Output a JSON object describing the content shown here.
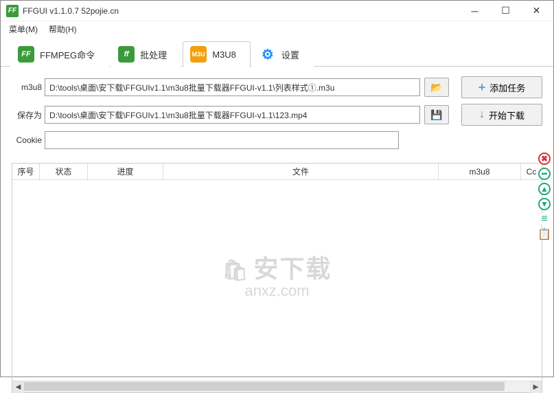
{
  "titlebar": {
    "icon_text": "FF",
    "title": "FFGUI v1.1.0.7    52pojie.cn"
  },
  "menubar": {
    "menu": "菜单(M)",
    "help": "帮助(H)"
  },
  "tabs": {
    "ffmpeg": "FFMPEG命令",
    "batch": "批处理",
    "m3u8": "M3U8",
    "settings": "设置",
    "icon_m3u8": "M3U"
  },
  "form": {
    "m3u8_label": "m3u8",
    "m3u8_value": "D:\\tools\\桌面\\安下载\\FFGUIv1.1\\m3u8批量下载器FFGUI-v1.1\\列表样式①.m3u",
    "save_label": "保存为",
    "save_value": "D:\\tools\\桌面\\安下载\\FFGUIv1.1\\m3u8批量下载器FFGUI-v1.1\\123.mp4",
    "cookie_label": "Cookie",
    "cookie_value": ""
  },
  "buttons": {
    "add_task": "添加任务",
    "start_download": "开始下载"
  },
  "table": {
    "columns": {
      "index": "序号",
      "status": "状态",
      "progress": "进度",
      "file": "文件",
      "m3u8": "m3u8",
      "cc": "Cc"
    },
    "rows": []
  },
  "watermark": {
    "title": "安下载",
    "subtitle": "anxz.com"
  }
}
